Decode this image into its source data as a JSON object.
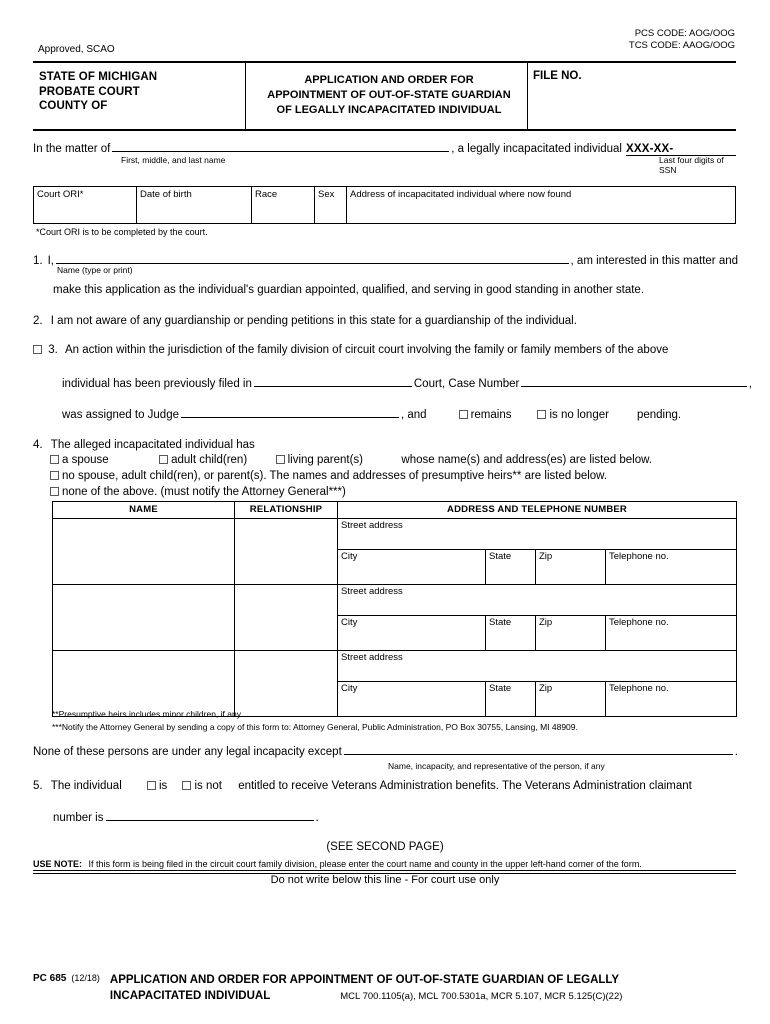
{
  "top_codes": {
    "pcs": "PCS CODE: AOG/OOG",
    "tcs": "TCS CODE: AAOG/OOG"
  },
  "approved": "Approved, SCAO",
  "header": {
    "left_line1": "STATE OF MICHIGAN",
    "left_line2": "PROBATE COURT",
    "left_line3": "COUNTY OF",
    "title_line1": "APPLICATION AND ORDER FOR",
    "title_line2": "APPOINTMENT OF OUT-OF-STATE GUARDIAN",
    "title_line3": "OF LEGALLY INCAPACITATED INDIVIDUAL",
    "file_no_label": "FILE NO."
  },
  "matter": {
    "prefix": "In the matter of",
    "suffix": ", a legally incapacitated individual",
    "name_caption": "First, middle, and last name",
    "ssn_value": "XXX-XX-",
    "ssn_caption": "Last four digits of SSN"
  },
  "ori_table": {
    "headers": [
      "Court ORI*",
      "Date of birth",
      "Race",
      "Sex",
      "Address of incapacitated individual where now found"
    ],
    "note": "*Court ORI is to be completed by the court."
  },
  "items": {
    "item1": {
      "number": "1.",
      "lead": "I,",
      "tail": ", am interested in this matter and",
      "caption": "Name (type or print)",
      "line2": "make this application as the individual's guardian appointed, qualified, and serving in good standing in another state."
    },
    "item2": {
      "number": "2.",
      "text": "I am not aware of any guardianship or pending petitions in this state for a guardianship of the individual."
    },
    "item3": {
      "number": "3.",
      "line1": "An action within the jurisdiction of the family division of circuit court involving the family or family members of the above",
      "line2_a": "individual has been previously filed in",
      "line2_b": "Court, Case Number",
      "line2_c": ",",
      "line3_a": "was assigned to Judge",
      "line3_b": ", and",
      "opt_remains": "remains",
      "opt_is_no_longer": "is no longer",
      "line3_tail": "pending."
    },
    "item4": {
      "number": "4.",
      "head": "The alleged incapacitated individual has",
      "opt_spouse": "a spouse",
      "opt_adult_child": "adult child(ren)",
      "opt_living_parent": "living parent(s)",
      "opt_tail": "whose name(s) and address(es) are listed below.",
      "opt_none_relatives": "no spouse, adult child(ren), or parent(s). The names and addresses of presumptive heirs** are listed below.",
      "opt_none_above": "none of the above. (must notify the Attorney General***)"
    },
    "item5": {
      "number": "5.",
      "lead": "The individual",
      "opt_is": "is",
      "opt_is_not": "is not",
      "tail": "entitled to receive Veterans Administration benefits. The Veterans Administration claimant",
      "line2_a": "number is",
      "line2_b": "."
    }
  },
  "persons_table": {
    "headers": [
      "NAME",
      "RELATIONSHIP",
      "ADDRESS AND TELEPHONE NUMBER"
    ],
    "sub_labels": {
      "street": "Street address",
      "city": "City",
      "state": "State",
      "zip": "Zip",
      "telephone": "Telephone no."
    },
    "rows": [
      {
        "name": "",
        "relationship": "",
        "street": "",
        "city": "",
        "state": "",
        "zip": "",
        "telephone": ""
      },
      {
        "name": "",
        "relationship": "",
        "street": "",
        "city": "",
        "state": "",
        "zip": "",
        "telephone": ""
      },
      {
        "name": "",
        "relationship": "",
        "street": "",
        "city": "",
        "state": "",
        "zip": "",
        "telephone": ""
      }
    ]
  },
  "footnotes": {
    "fn2": "**Presumptive heirs includes minor children, if any.",
    "fn3": "***Notify the Attorney General by sending a copy of this form to: Attorney General, Public Administration, PO Box 30755, Lansing, MI 48909."
  },
  "none_incapacity": {
    "text": "None of these persons are under any legal incapacity except",
    "tail": ".",
    "caption": "Name, incapacity, and representative of the person, if any"
  },
  "bottom": {
    "see_second_page": "(SEE SECOND PAGE)",
    "use_note_label": "USE NOTE:",
    "use_note_text": "If this form is being filed in the circuit court family division, please enter the court name and county in the upper left-hand corner of the form.",
    "court_use_only": "Do not write below this line - For court use only"
  },
  "footer": {
    "form_id": "PC  685",
    "form_date": "(12/18)",
    "title_line1": "APPLICATION AND ORDER FOR APPOINTMENT OF OUT-OF-STATE GUARDIAN OF LEGALLY",
    "title_line2": "INCAPACITATED INDIVIDUAL",
    "citation": "MCL 700.1105(a), MCL 700.5301a, MCR 5.107, MCR 5.125(C)(22)"
  }
}
